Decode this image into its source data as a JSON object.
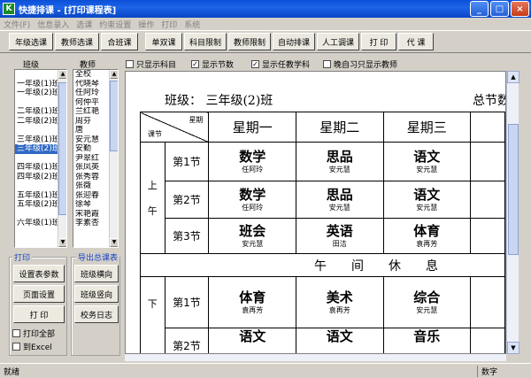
{
  "window": {
    "title": "快捷排课 - [打印课程表]",
    "icon": "app-icon"
  },
  "menu": [
    "文件(F)",
    "信息录入",
    "选课",
    "约束设置",
    "操作",
    "打印",
    "系统"
  ],
  "toolbar": [
    "年级选课",
    "教师选课",
    "合班课",
    "单双课",
    "科目限制",
    "教师限制",
    "自动排课",
    "人工调课",
    "打 印",
    "代 课"
  ],
  "left": {
    "class_label": "班级",
    "teacher_label": "教师"
  },
  "classes": [
    "",
    "一年级(1)班",
    "一年级(2)班",
    "",
    "二年级(1)班",
    "二年级(2)班",
    "",
    "三年级(1)班",
    "三年级(2)班",
    "",
    "四年级(1)班",
    "四年级(2)班",
    "",
    "五年级(1)班",
    "五年级(2)班",
    "",
    "六年级(1)班"
  ],
  "classes_selected_index": 8,
  "teachers": [
    "全校",
    "代晓琴",
    "任阿玲",
    "何仲平",
    "兰红艳",
    "周芬",
    "唐",
    "安元慧",
    "安勤",
    "尹翠红",
    "张凤英",
    "张秀蓉",
    "张薇",
    "张迎春",
    "徐琴",
    "宋艳霞",
    "李素杏"
  ],
  "options": [
    {
      "label": "只显示科目",
      "checked": false
    },
    {
      "label": "显示节数",
      "checked": true
    },
    {
      "label": "显示任教学科",
      "checked": true
    },
    {
      "label": "晚自习只显示教师",
      "checked": false
    }
  ],
  "print": {
    "title": "打印",
    "setup": "设置表参数",
    "page": "页面设置",
    "print": "打 印",
    "print_all": "打印全部",
    "to_excel": "到Excel"
  },
  "export": {
    "title": "导出总课表",
    "horizontal": "班级横向",
    "vertical": "班级竖向",
    "log": "校务日志"
  },
  "timetable": {
    "class_title": "班级：  三年级(2)班",
    "summary": "总节数",
    "corner_top": "星期",
    "corner_bottom": "课节",
    "days": [
      "星期一",
      "星期二",
      "星期三"
    ],
    "morning": "上\n\n午",
    "afternoon": "下",
    "rest_row": "午　　间　　休　　息",
    "rows": [
      {
        "section": "第1节",
        "cells": [
          {
            "subject": "数学",
            "teacher": "任阿玲"
          },
          {
            "subject": "思品",
            "teacher": "安元慧"
          },
          {
            "subject": "语文",
            "teacher": "安元慧"
          }
        ]
      },
      {
        "section": "第2节",
        "cells": [
          {
            "subject": "数学",
            "teacher": "任阿玲"
          },
          {
            "subject": "思品",
            "teacher": "安元慧"
          },
          {
            "subject": "语文",
            "teacher": "安元慧"
          }
        ]
      },
      {
        "section": "第3节",
        "cells": [
          {
            "subject": "班会",
            "teacher": "安元慧"
          },
          {
            "subject": "英语",
            "teacher": "田洁"
          },
          {
            "subject": "体育",
            "teacher": "袁再芳"
          }
        ]
      },
      {
        "section": "第1节",
        "cells": [
          {
            "subject": "体育",
            "teacher": "袁再芳"
          },
          {
            "subject": "美术",
            "teacher": "袁再芳"
          },
          {
            "subject": "综合",
            "teacher": "安元慧"
          }
        ]
      },
      {
        "section": "第2节",
        "cells": [
          {
            "subject": "语文",
            "teacher": ""
          },
          {
            "subject": "语文",
            "teacher": ""
          },
          {
            "subject": "音乐",
            "teacher": ""
          }
        ]
      }
    ]
  },
  "status": {
    "left": "就绪",
    "right": "数字"
  }
}
